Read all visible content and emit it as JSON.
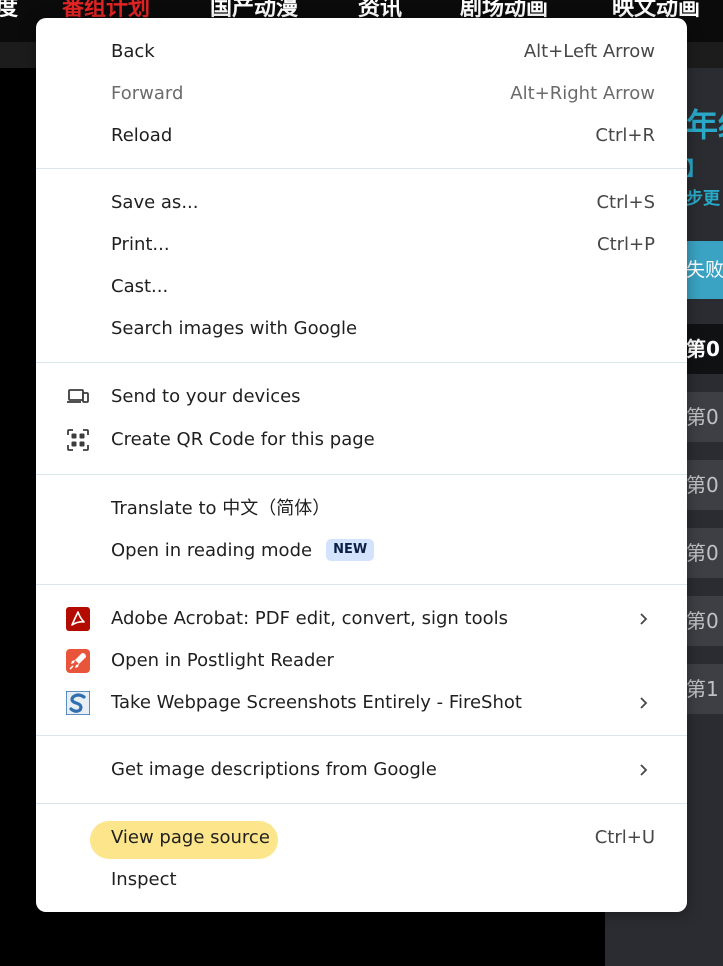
{
  "background": {
    "top_nav": [
      "度",
      "番组计划",
      "国产动漫",
      "资讯",
      "剧场动画",
      "映文动画"
    ],
    "right_panel": {
      "title": "年经",
      "bracket": "】",
      "line": "步更",
      "button": "失败",
      "episodes": [
        "第0",
        "第0",
        "第0",
        "第0",
        "第0",
        "第1"
      ]
    }
  },
  "menu": {
    "items": {
      "back": {
        "label": "Back",
        "shortcut": "Alt+Left Arrow"
      },
      "forward": {
        "label": "Forward",
        "shortcut": "Alt+Right Arrow",
        "disabled": true
      },
      "reload": {
        "label": "Reload",
        "shortcut": "Ctrl+R"
      },
      "save_as": {
        "label": "Save as...",
        "shortcut": "Ctrl+S"
      },
      "print": {
        "label": "Print...",
        "shortcut": "Ctrl+P"
      },
      "cast": {
        "label": "Cast..."
      },
      "search_images": {
        "label": "Search images with Google"
      },
      "send_devices": {
        "label": "Send to your devices",
        "icon": "devices-icon"
      },
      "qr_code": {
        "label": "Create QR Code for this page",
        "icon": "qr-code-icon"
      },
      "translate": {
        "label": "Translate to 中文（简体）"
      },
      "reading_mode": {
        "label": "Open in reading mode",
        "badge": "NEW"
      },
      "acrobat": {
        "label": "Adobe Acrobat: PDF edit, convert, sign tools",
        "icon": "adobe-acrobat-icon",
        "submenu": true
      },
      "postlight": {
        "label": "Open in Postlight Reader",
        "icon": "postlight-reader-icon"
      },
      "fireshot": {
        "label": "Take Webpage Screenshots Entirely - FireShot",
        "icon": "fireshot-icon",
        "submenu": true
      },
      "image_descriptions": {
        "label": "Get image descriptions from Google",
        "submenu": true
      },
      "view_source": {
        "label": "View page source",
        "shortcut": "Ctrl+U",
        "highlighted": true
      },
      "inspect": {
        "label": "Inspect"
      }
    }
  },
  "colors": {
    "highlight": "#fce58a",
    "badge_bg": "#d3e3fd",
    "separator": "#d9e6ee",
    "accent_teal": "#29a9c7",
    "acrobat_red": "#b30b00",
    "postlight_orange": "#e8553a",
    "fireshot_blue": "#2f6fb0"
  }
}
